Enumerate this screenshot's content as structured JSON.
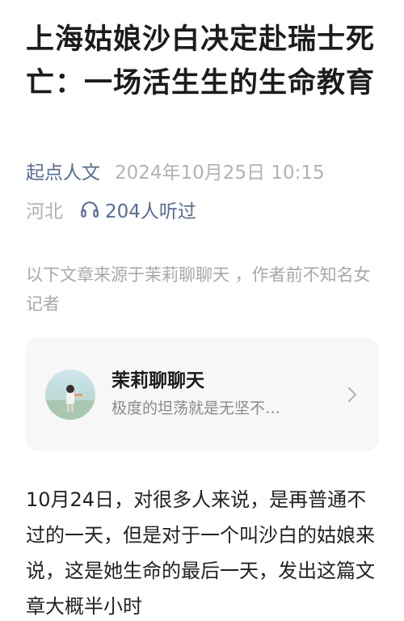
{
  "article": {
    "title": "上海姑娘沙白决定赴瑞士死亡：一场活生生的生命教育",
    "source": "起点人文",
    "timestamp": "2024年10月25日 10:15",
    "location": "河北",
    "listen_count": "204人听过",
    "intro": "以下文章来源于茉莉聊聊天 ，作者前不知名女记者",
    "body": "10月24日，对很多人来说，是再普通不过的一天，但是对于一个叫沙白的姑娘来说，这是她生命的最后一天，发出这篇文章大概半小时"
  },
  "card": {
    "name": "茉莉聊聊天",
    "description": "极度的坦荡就是无坚不…"
  },
  "icons": {
    "listen": "headphone-icon",
    "card_arrow": "chevron-right-icon"
  },
  "colors": {
    "link": "#576b95",
    "muted": "#b2b2b2",
    "card_bg": "#f7f7f7"
  }
}
